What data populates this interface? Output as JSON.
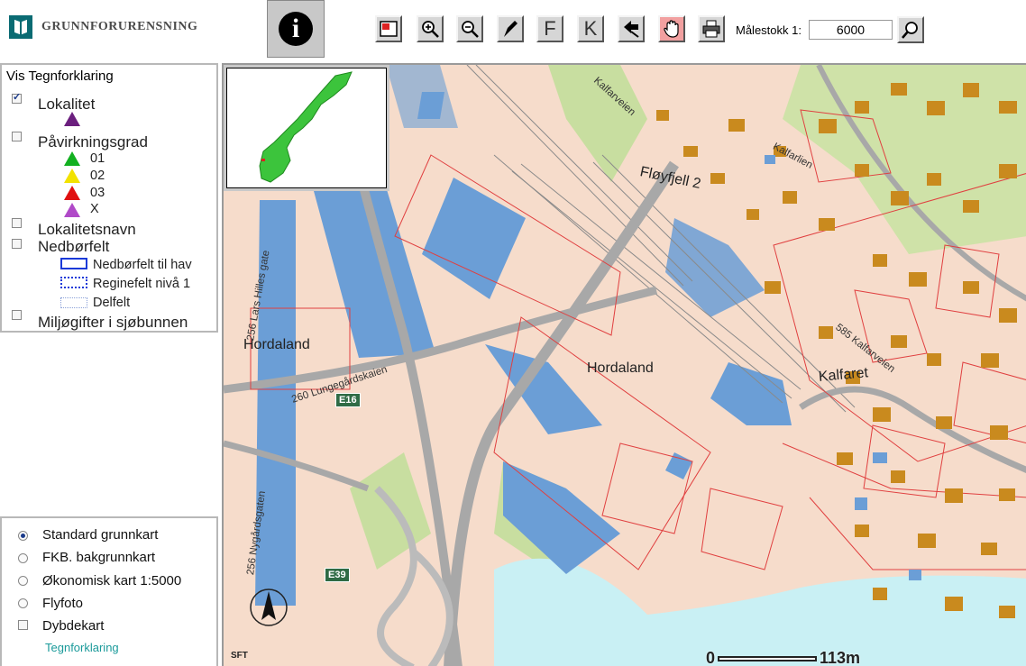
{
  "header": {
    "logo_text": "GRUNNFORURENSNING",
    "scale_label": "Målestokk 1:",
    "scale_value": "6000"
  },
  "toolbar": {
    "info": "i",
    "tool_f": "F",
    "tool_k": "K"
  },
  "legend": {
    "title": "Vis Tegnforklaring",
    "layers": [
      {
        "label": "Lokalitet",
        "checked": true
      },
      {
        "label": "Påvirkningsgrad",
        "checked": false
      },
      {
        "label": "Lokalitetsnavn",
        "checked": false
      },
      {
        "label": "Nedbørfelt",
        "checked": false
      },
      {
        "label": "Miljøgifter i sjøbunnen",
        "checked": false
      }
    ],
    "grades": [
      "01",
      "02",
      "03",
      "X"
    ],
    "catchment": [
      "Nedbørfelt til hav",
      "Reginefelt nivå 1",
      "Delfelt"
    ]
  },
  "basemaps": {
    "options": [
      "Standard grunnkart",
      "FKB. bakgrunnkart",
      "Økonomisk kart 1:5000",
      "Flyfoto",
      "Dybdekart"
    ],
    "selected": "Standard grunnkart",
    "link": "Tegnforklaring"
  },
  "map": {
    "labels": {
      "hordaland_center": "Hordaland",
      "hordaland_left": "Hordaland",
      "floyfjell": "Fløyfjell 2",
      "kalfaret": "Kalfaret"
    },
    "roads": {
      "kalfarveien_top": "Kalfarveien",
      "kalfarlien": "Kalfarlien",
      "kalfarveien_right": "585 Kalfarveien",
      "lars_hilles": "256 Lars Hilles gate",
      "lungegardskaien": "260 Lungegårdskaien",
      "nygardsgaten": "256 Nygårdsgaten"
    },
    "routes": {
      "e16": "E16",
      "e39": "E39"
    },
    "scale": {
      "start": "0",
      "end": "113m"
    },
    "credit": "SFT",
    "colors": {
      "land": "#f6dccb",
      "water": "#6b9ed6",
      "building": "#c98a1e",
      "sea": "#c9f0f4",
      "green": "#c8dea0",
      "road": "#a8a8a8"
    }
  }
}
